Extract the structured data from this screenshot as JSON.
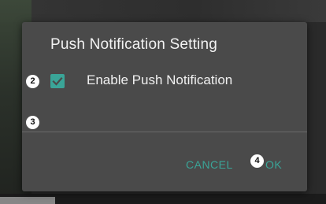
{
  "dialog": {
    "title": "Push Notification Setting",
    "option": {
      "label": "Enable Push Notification",
      "checked": true
    },
    "buttons": {
      "cancel_label": "CANCEL",
      "ok_label": "OK"
    }
  },
  "annotations": {
    "badge_2": "2",
    "badge_3": "3",
    "badge_4": "4"
  },
  "colors": {
    "accent": "#3aa598",
    "dialog_bg": "#4a4a4a",
    "text": "#f0f0f0"
  },
  "icons": {
    "checkbox": "checkmark-icon"
  }
}
